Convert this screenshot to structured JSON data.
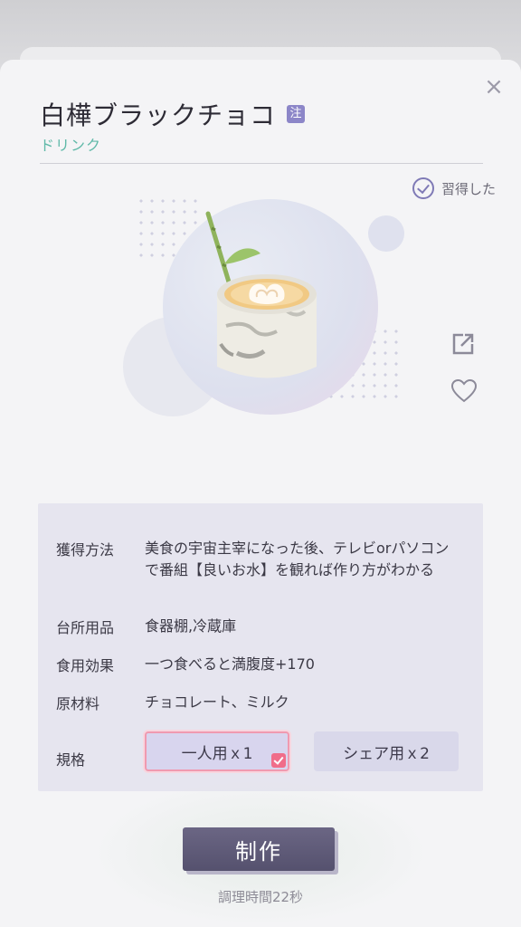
{
  "header": {
    "title": "白樺ブラックチョコ",
    "note_badge": "注",
    "category": "ドリンク",
    "close_icon": "close-icon"
  },
  "status": {
    "learned_label": "習得した",
    "learned_icon": "check-circle-icon"
  },
  "side_actions": {
    "share_icon": "share-icon",
    "favorite_icon": "heart-icon"
  },
  "info": {
    "acquire": {
      "label": "獲得方法",
      "value": "美食の宇宙主宰になった後、テレビorパソコンで番組【良いお水】を観れば作り方がわかる"
    },
    "kitchen": {
      "label": "台所用品",
      "value": "食器棚,冷蔵庫"
    },
    "effect": {
      "label": "食用効果",
      "value": "一つ食べると満腹度+170"
    },
    "ingredients": {
      "label": "原材料",
      "value": "チョコレート、ミルク"
    },
    "spec": {
      "label": "規格",
      "options": [
        "一人用ｘ1",
        "シェア用ｘ2"
      ],
      "selected": "一人用ｘ1"
    }
  },
  "craft": {
    "button_label": "制作",
    "cook_time": "調理時間22秒"
  },
  "colors": {
    "accent": "#7f7ab6",
    "category": "#5fb9a8",
    "selected_border": "#f09ab0",
    "button": "#5f5a78"
  }
}
